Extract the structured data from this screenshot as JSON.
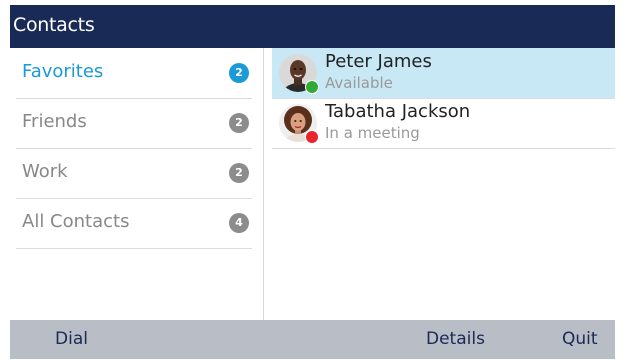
{
  "title": "Contacts",
  "colors": {
    "title_bar": "#1a2a56",
    "accent": "#1a9ad6",
    "selected_row": "#c8e8f5",
    "badge_inactive": "#8c8c8c",
    "softkey_bar": "#b9bdc6",
    "status_available": "#33aa33",
    "status_busy": "#e8242c"
  },
  "sidebar": {
    "items": [
      {
        "label": "Favorites",
        "count": "2",
        "active": true
      },
      {
        "label": "Friends",
        "count": "2",
        "active": false
      },
      {
        "label": "Work",
        "count": "2",
        "active": false
      },
      {
        "label": "All Contacts",
        "count": "4",
        "active": false
      }
    ]
  },
  "contacts": [
    {
      "name": "Peter James",
      "status": "Available",
      "presence": "available",
      "selected": true,
      "icon": "person-avatar-icon"
    },
    {
      "name": "Tabatha Jackson",
      "status": "In a meeting",
      "presence": "busy",
      "selected": false,
      "icon": "person-avatar-icon"
    }
  ],
  "softkeys": {
    "dial": "Dial",
    "details": "Details",
    "quit": "Quit"
  }
}
